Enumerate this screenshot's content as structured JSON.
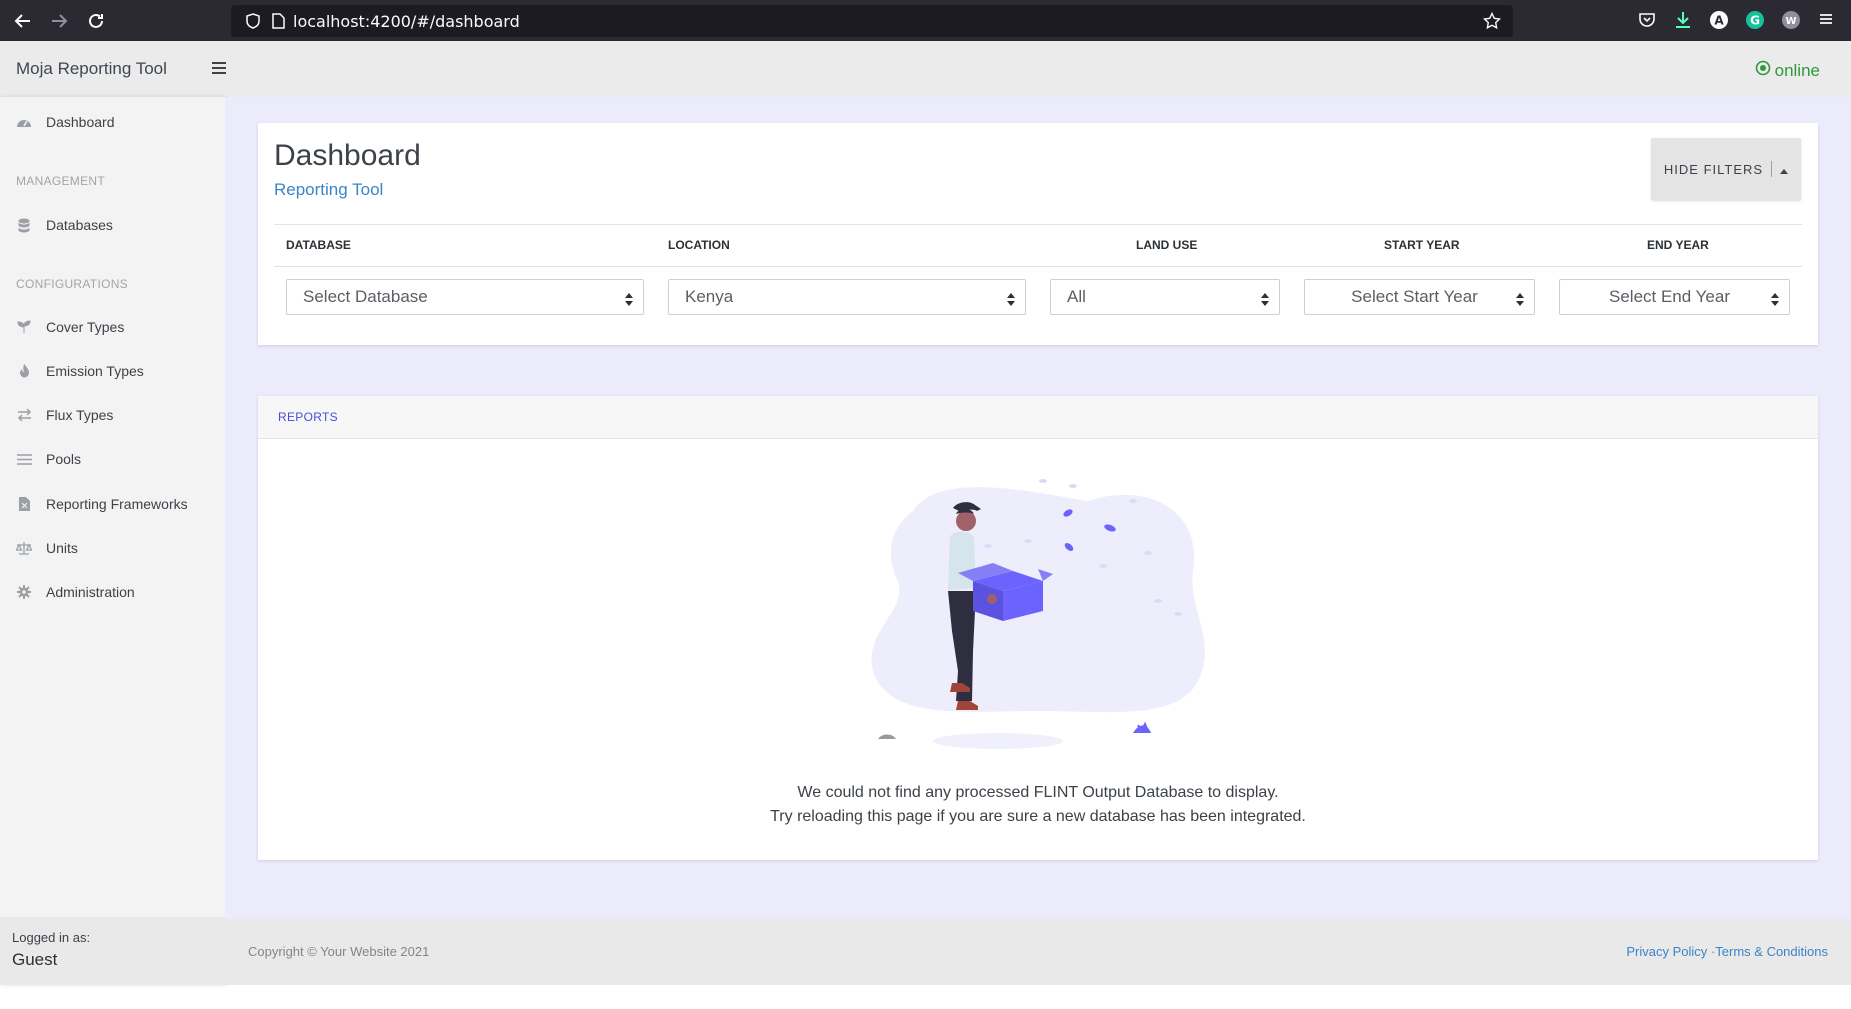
{
  "browser": {
    "url": "localhost:4200/#/dashboard"
  },
  "header": {
    "brand": "Moja Reporting Tool",
    "status": "online",
    "status_color": "#2e9a3a"
  },
  "sidebar": {
    "dashboard": "Dashboard",
    "management_heading": "MANAGEMENT",
    "databases": "Databases",
    "configurations_heading": "CONFIGURATIONS",
    "items": [
      {
        "label": "Cover Types",
        "icon": "seedling-icon"
      },
      {
        "label": "Emission Types",
        "icon": "fire-icon"
      },
      {
        "label": "Flux Types",
        "icon": "exchange-icon"
      },
      {
        "label": "Pools",
        "icon": "bars-icon"
      },
      {
        "label": "Reporting Frameworks",
        "icon": "file-icon"
      },
      {
        "label": "Units",
        "icon": "balance-scale-icon"
      },
      {
        "label": "Administration",
        "icon": "gear-icon"
      }
    ],
    "logged_in_label": "Logged in as:",
    "user": "Guest"
  },
  "dashboard": {
    "title": "Dashboard",
    "subtitle": "Reporting Tool",
    "hide_filters": "HIDE FILTERS",
    "filters": {
      "database_label": "DATABASE",
      "location_label": "LOCATION",
      "land_use_label": "LAND USE",
      "start_year_label": "START YEAR",
      "end_year_label": "END YEAR",
      "database_value": "Select Database",
      "location_value": "Kenya",
      "land_use_value": "All",
      "start_year_value": "Select Start Year",
      "end_year_value": "Select End Year"
    }
  },
  "reports": {
    "heading": "REPORTS",
    "message_line1": "We could not find any processed FLINT Output Database to display.",
    "message_line2": "Try reloading this page if you are sure a new database has been integrated."
  },
  "footer": {
    "copyright": "Copyright © Your Website 2021",
    "privacy": "Privacy Policy",
    "separator": "·",
    "terms": "Terms & Conditions"
  },
  "colors": {
    "accent": "#3a84c8",
    "main_bg": "#ebebfc",
    "illustration": "#6c63ff"
  }
}
